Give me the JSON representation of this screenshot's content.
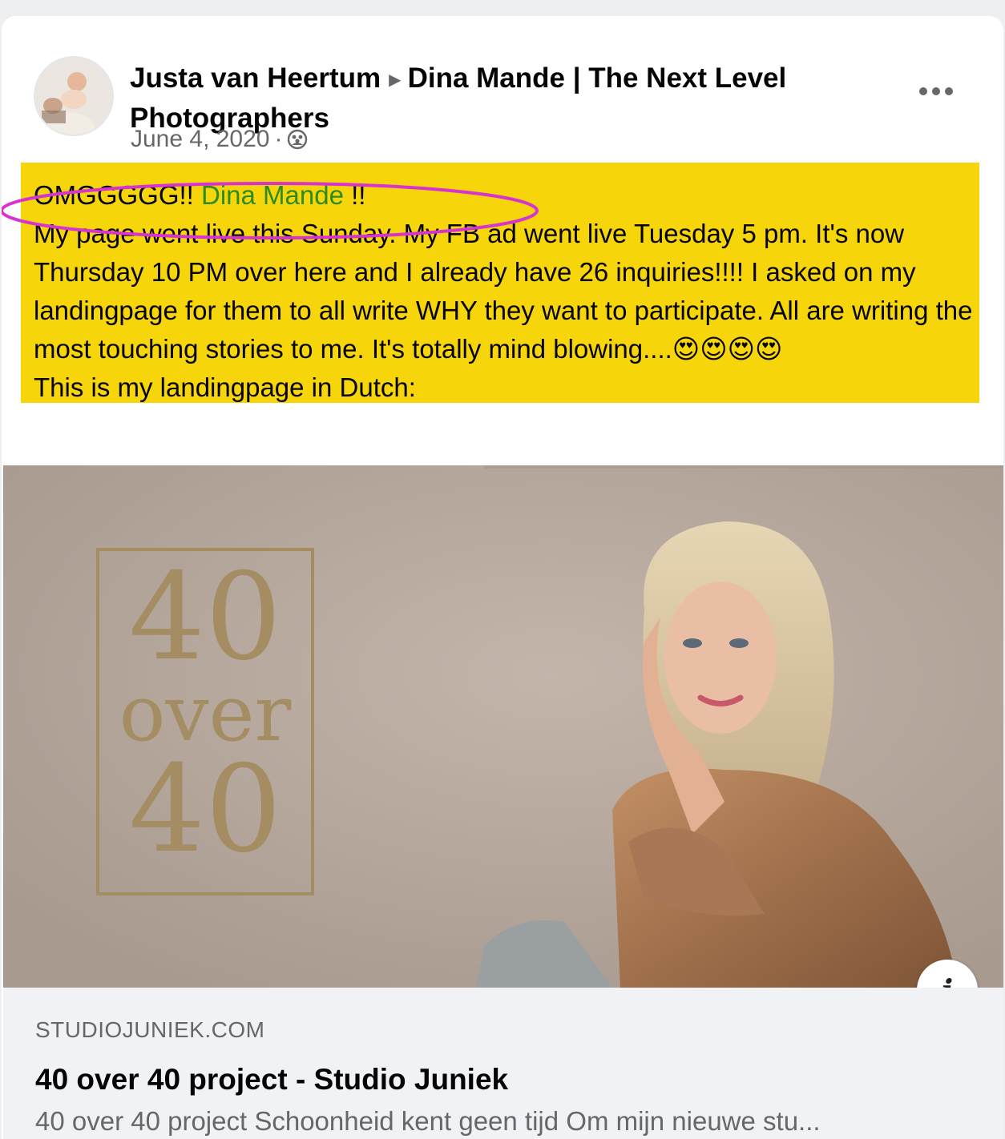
{
  "post": {
    "author": "Justa van Heertum",
    "group": "Dina Mande | The Next Level Photographers",
    "date": "June 4, 2020",
    "separator": "·",
    "privacy_icon": "group-members-icon",
    "more_icon": "more-options-icon",
    "body": {
      "line1_prefix": "OMGGGGG!! ",
      "mention": "Dina Mande",
      "line1_suffix": " !!",
      "paragraph": "My page went live this Sunday. My FB ad went live Tuesday 5 pm. It's now Thursday 10 PM over here and I already have 26 inquiries!!!! I asked on my landingpage for them to all write WHY they want to participate. All are writing the most touching stories to me. It's totally mind blowing....😍😍😍😍",
      "closing": "This is my landingpage in Dutch:"
    },
    "colors": {
      "highlight": "#f7d50b",
      "annotation_ellipse": "#d633d1",
      "mention": "#2e8b1e"
    }
  },
  "link_preview": {
    "image_logo": [
      "40",
      "over",
      "40"
    ],
    "info_icon": "info-icon",
    "info_label": "i",
    "domain": "STUDIOJUNIEK.COM",
    "title": "40 over 40 project - Studio Juniek",
    "description": "40 over 40 project Schoonheid kent geen tijd Om mijn nieuwe stu..."
  }
}
